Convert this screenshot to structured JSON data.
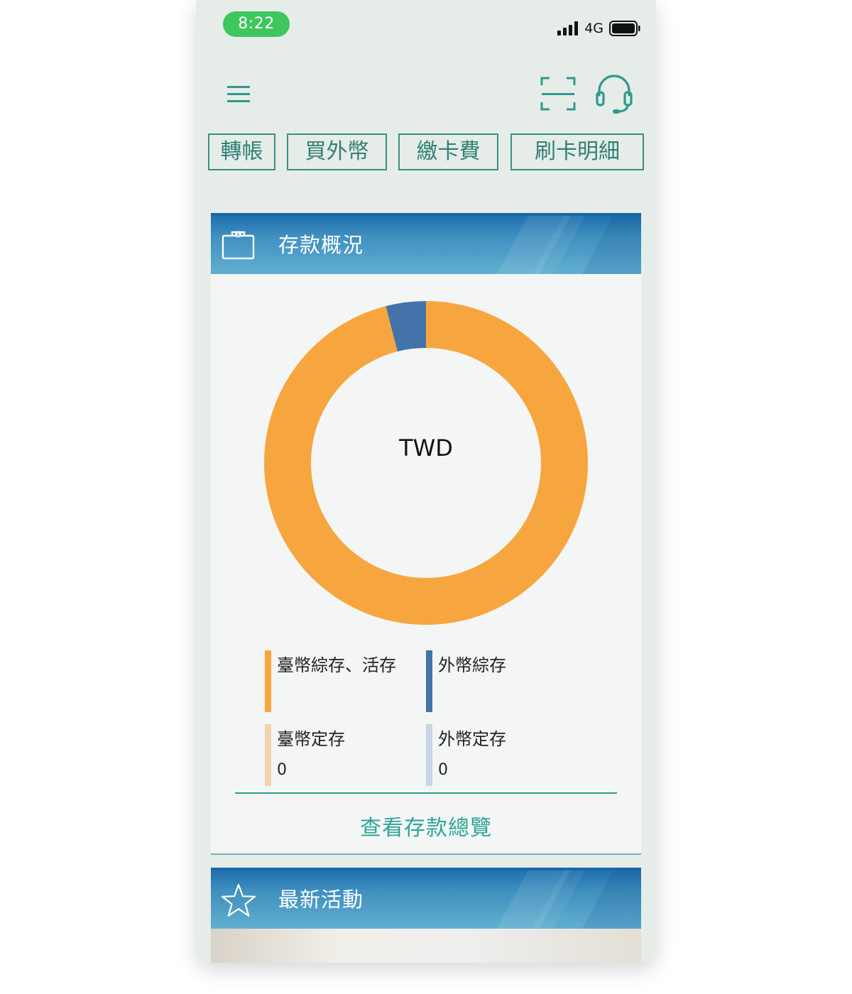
{
  "status_bar": {
    "time": "8:22",
    "network": "4G",
    "signal_icon": "signal-bars-icon",
    "battery_icon": "battery-icon"
  },
  "toolbar": {
    "menu_icon": "hamburger-menu-icon",
    "scan_icon": "scan-qr-icon",
    "support_icon": "headset-support-icon"
  },
  "quick_actions": [
    {
      "label": "轉帳"
    },
    {
      "label": "買外幣"
    },
    {
      "label": "繳卡費"
    },
    {
      "label": "刷卡明細"
    }
  ],
  "deposit_card": {
    "title": "存款概況",
    "icon": "briefcase-money-icon",
    "center_label": "TWD",
    "legend": [
      {
        "label": "臺幣綜存、活存",
        "value": "",
        "color": "#f7a63f"
      },
      {
        "label": "外幣綜存",
        "value": "",
        "color": "#4473aa"
      },
      {
        "label": "臺幣定存",
        "value": "0",
        "color": "#f4d2ad"
      },
      {
        "label": "外幣定存",
        "value": "0",
        "color": "#c8d5e4"
      }
    ],
    "view_all_label": "查看存款總覽"
  },
  "activity_card": {
    "title": "最新活動",
    "icon": "star-icon"
  },
  "colors": {
    "accent": "#2f8077",
    "header_blue": "#1f70ad",
    "twd_current": "#f7a63f",
    "foreign_current": "#4473aa",
    "background": "#e6ece7"
  },
  "chart_data": {
    "type": "pie",
    "donut": true,
    "categories": [
      "臺幣綜存、活存",
      "外幣綜存",
      "臺幣定存",
      "外幣定存"
    ],
    "values": [
      96,
      4,
      0,
      0
    ],
    "colors": [
      "#f7a63f",
      "#4473aa",
      "#f4d2ad",
      "#c8d5e4"
    ],
    "title": "",
    "center_text": "TWD",
    "legend": "bottom"
  }
}
